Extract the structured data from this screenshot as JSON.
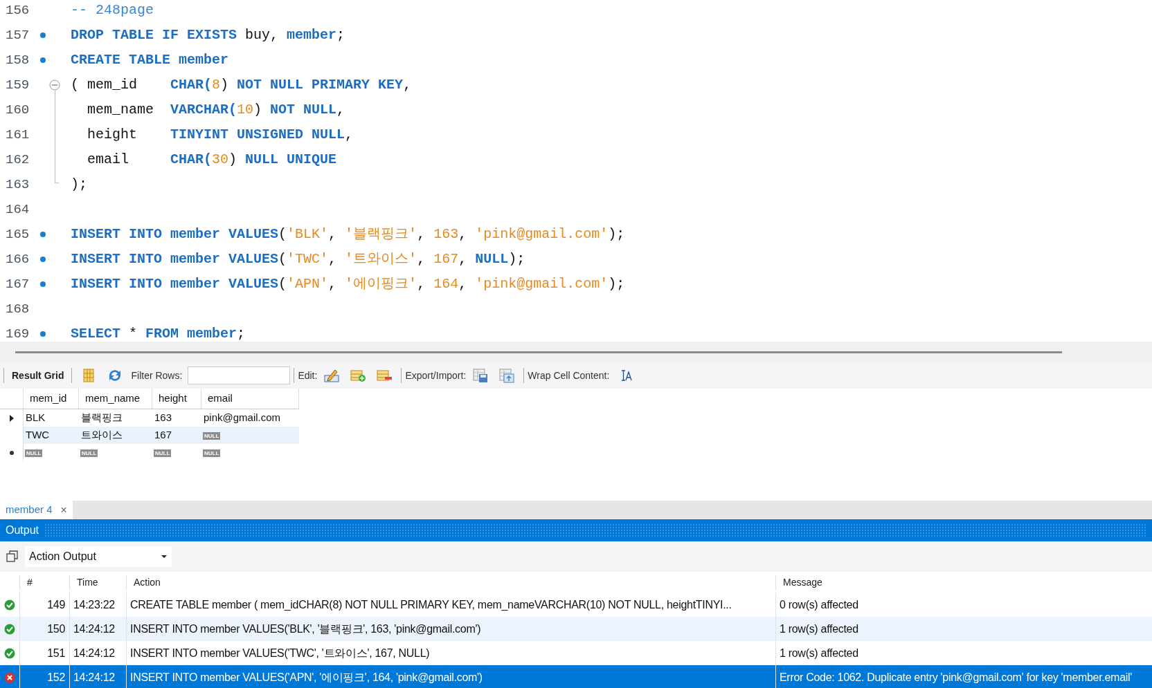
{
  "editor": {
    "lines": [
      {
        "number": "156",
        "marker": false,
        "fold_start": false,
        "fold_body": false,
        "tokens": [
          {
            "text": "-- 248page",
            "kind": "comment"
          }
        ]
      },
      {
        "number": "157",
        "marker": true,
        "fold_start": false,
        "fold_body": false,
        "tokens": [
          {
            "text": "DROP TABLE IF EXISTS",
            "kind": "keyword"
          },
          {
            "text": " buy, ",
            "kind": "plain"
          },
          {
            "text": "member",
            "kind": "ident"
          },
          {
            "text": ";",
            "kind": "plain"
          }
        ]
      },
      {
        "number": "158",
        "marker": true,
        "fold_start": false,
        "fold_body": false,
        "tokens": [
          {
            "text": "CREATE TABLE member",
            "kind": "keyword"
          }
        ]
      },
      {
        "number": "159",
        "marker": false,
        "fold_start": true,
        "fold_body": false,
        "tokens": [
          {
            "text": "( mem_id    ",
            "kind": "plain"
          },
          {
            "text": "CHAR(",
            "kind": "keyword"
          },
          {
            "text": "8",
            "kind": "number"
          },
          {
            "text": ") ",
            "kind": "plain"
          },
          {
            "text": "NOT NULL PRIMARY KEY",
            "kind": "keyword"
          },
          {
            "text": ",",
            "kind": "plain"
          }
        ]
      },
      {
        "number": "160",
        "marker": false,
        "fold_start": false,
        "fold_body": true,
        "tokens": [
          {
            "text": "  mem_name  ",
            "kind": "plain"
          },
          {
            "text": "VARCHAR(",
            "kind": "keyword"
          },
          {
            "text": "10",
            "kind": "number"
          },
          {
            "text": ") ",
            "kind": "plain"
          },
          {
            "text": "NOT NULL",
            "kind": "keyword"
          },
          {
            "text": ",",
            "kind": "plain"
          }
        ]
      },
      {
        "number": "161",
        "marker": false,
        "fold_start": false,
        "fold_body": true,
        "tokens": [
          {
            "text": "  height    ",
            "kind": "plain"
          },
          {
            "text": "TINYINT UNSIGNED NULL",
            "kind": "keyword"
          },
          {
            "text": ",",
            "kind": "plain"
          }
        ]
      },
      {
        "number": "162",
        "marker": false,
        "fold_start": false,
        "fold_body": true,
        "tokens": [
          {
            "text": "  email     ",
            "kind": "plain"
          },
          {
            "text": "CHAR(",
            "kind": "keyword"
          },
          {
            "text": "30",
            "kind": "number"
          },
          {
            "text": ") ",
            "kind": "plain"
          },
          {
            "text": "NULL UNIQUE",
            "kind": "keyword"
          }
        ]
      },
      {
        "number": "163",
        "marker": false,
        "fold_start": false,
        "fold_body": true,
        "tokens": [
          {
            "text": ");",
            "kind": "plain"
          }
        ]
      },
      {
        "number": "164",
        "marker": false,
        "fold_start": false,
        "fold_body": false
      },
      {
        "number": "165",
        "marker": true,
        "fold_start": false,
        "fold_body": false,
        "tokens": [
          {
            "text": "INSERT INTO member VALUES",
            "kind": "keyword"
          },
          {
            "text": "(",
            "kind": "plain"
          },
          {
            "text": "'BLK'",
            "kind": "string"
          },
          {
            "text": ", ",
            "kind": "plain"
          },
          {
            "text": "'블랙핑크'",
            "kind": "string"
          },
          {
            "text": ", ",
            "kind": "plain"
          },
          {
            "text": "163",
            "kind": "number"
          },
          {
            "text": ", ",
            "kind": "plain"
          },
          {
            "text": "'pink@gmail.com'",
            "kind": "string"
          },
          {
            "text": ");",
            "kind": "plain"
          }
        ]
      },
      {
        "number": "166",
        "marker": true,
        "fold_start": false,
        "fold_body": false,
        "tokens": [
          {
            "text": "INSERT INTO member VALUES",
            "kind": "keyword"
          },
          {
            "text": "(",
            "kind": "plain"
          },
          {
            "text": "'TWC'",
            "kind": "string"
          },
          {
            "text": ", ",
            "kind": "plain"
          },
          {
            "text": "'트와이스'",
            "kind": "string"
          },
          {
            "text": ", ",
            "kind": "plain"
          },
          {
            "text": "167",
            "kind": "number"
          },
          {
            "text": ", ",
            "kind": "plain"
          },
          {
            "text": "NULL",
            "kind": "keyword"
          },
          {
            "text": ");",
            "kind": "plain"
          }
        ]
      },
      {
        "number": "167",
        "marker": true,
        "fold_start": false,
        "fold_body": false,
        "tokens": [
          {
            "text": "INSERT INTO member VALUES",
            "kind": "keyword"
          },
          {
            "text": "(",
            "kind": "plain"
          },
          {
            "text": "'APN'",
            "kind": "string"
          },
          {
            "text": ", ",
            "kind": "plain"
          },
          {
            "text": "'에이핑크'",
            "kind": "string"
          },
          {
            "text": ", ",
            "kind": "plain"
          },
          {
            "text": "164",
            "kind": "number"
          },
          {
            "text": ", ",
            "kind": "plain"
          },
          {
            "text": "'pink@gmail.com'",
            "kind": "string"
          },
          {
            "text": ");",
            "kind": "plain"
          }
        ]
      },
      {
        "number": "168",
        "marker": false,
        "fold_start": false,
        "fold_body": false
      },
      {
        "number": "169",
        "marker": true,
        "fold_start": false,
        "fold_body": false,
        "tokens": [
          {
            "text": "SELECT",
            "kind": "keyword"
          },
          {
            "text": " * ",
            "kind": "plain"
          },
          {
            "text": "FROM member",
            "kind": "keyword"
          },
          {
            "text": ";",
            "kind": "plain"
          }
        ]
      }
    ]
  },
  "result_toolbar": {
    "result_grid": "Result Grid",
    "filter_label": "Filter Rows:",
    "edit_label": "Edit:",
    "export_label": "Export/Import:",
    "wrap_label": "Wrap Cell Content:"
  },
  "result_grid": {
    "columns": [
      "mem_id",
      "mem_name",
      "height",
      "email"
    ],
    "rows": [
      {
        "current": true,
        "hovered": false,
        "new_row": false,
        "cells": [
          {
            "text": "BLK",
            "kind": "value"
          },
          {
            "text": "블랙핑크",
            "kind": "value"
          },
          {
            "text": "163",
            "kind": "value"
          },
          {
            "text": "pink@gmail.com",
            "kind": "value"
          }
        ]
      },
      {
        "current": false,
        "hovered": true,
        "new_row": false,
        "cells": [
          {
            "text": "TWC",
            "kind": "value"
          },
          {
            "text": "트와이스",
            "kind": "value"
          },
          {
            "text": "167",
            "kind": "value"
          },
          {
            "text": "NULL",
            "kind": "null"
          }
        ]
      },
      {
        "current": false,
        "hovered": false,
        "new_row": true,
        "cells": [
          {
            "text": "NULL",
            "kind": "null"
          },
          {
            "text": "NULL",
            "kind": "null"
          },
          {
            "text": "NULL",
            "kind": "null"
          },
          {
            "text": "NULL",
            "kind": "null"
          }
        ]
      }
    ]
  },
  "result_tabs": [
    {
      "label": "member 4",
      "selected": true,
      "close": "×"
    }
  ],
  "output": {
    "title": "Output",
    "selector": "Action Output",
    "columns": [
      "#",
      "Time",
      "Action",
      "Message"
    ],
    "rows": [
      {
        "failed": false,
        "selected": false,
        "hovered": false,
        "number": "149",
        "time": "14:23:22",
        "action": "CREATE TABLE member ( mem_idCHAR(8) NOT NULL PRIMARY KEY,   mem_nameVARCHAR(10) NOT NULL,   heightTINYI...",
        "message": "0 row(s) affected"
      },
      {
        "failed": false,
        "selected": false,
        "hovered": true,
        "number": "150",
        "time": "14:24:12",
        "action": "INSERT INTO member VALUES('BLK', '블랙핑크', 163, 'pink@gmail.com')",
        "message": "1 row(s) affected"
      },
      {
        "failed": false,
        "selected": false,
        "hovered": false,
        "number": "151",
        "time": "14:24:12",
        "action": "INSERT INTO member VALUES('TWC', '트와이스', 167, NULL)",
        "message": "1 row(s) affected"
      },
      {
        "failed": true,
        "selected": true,
        "hovered": false,
        "number": "152",
        "time": "14:24:12",
        "action": "INSERT INTO member VALUES('APN', '에이핑크', 164, 'pink@gmail.com')",
        "message": "Error Code: 1062. Duplicate entry 'pink@gmail.com' for key 'member.email'"
      }
    ]
  }
}
